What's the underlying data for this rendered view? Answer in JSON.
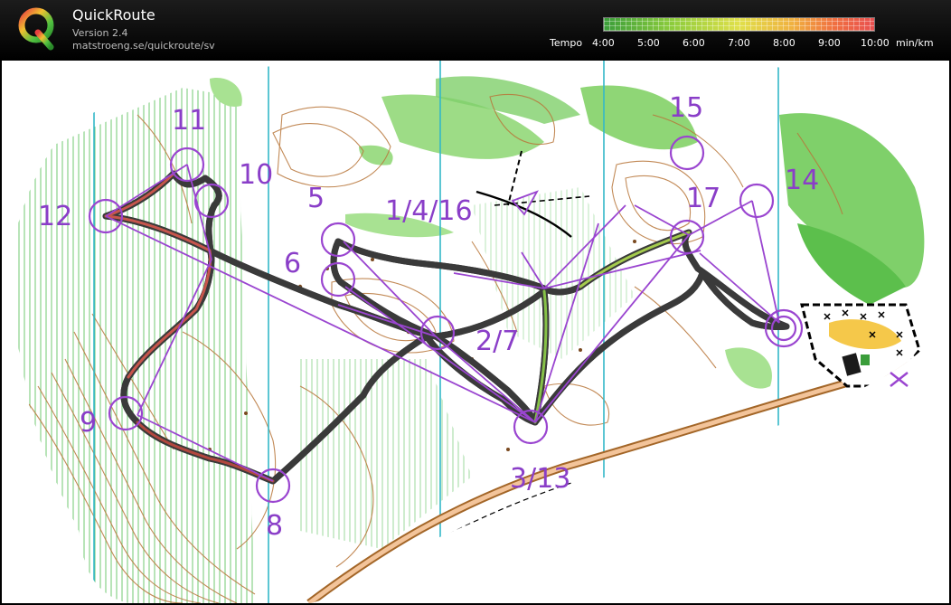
{
  "app": {
    "title": "QuickRoute",
    "version": "Version 2.4",
    "url": "matstroeng.se/quickroute/sv"
  },
  "tempo_legend": {
    "label": "Tempo",
    "ticks": [
      "4:00",
      "5:00",
      "6:00",
      "7:00",
      "8:00",
      "9:00",
      "10:00"
    ],
    "unit": "min/km",
    "colors": [
      "#3a9d3a",
      "#8ccc3c",
      "#e0e04a",
      "#f0b040",
      "#f07040",
      "#e85050"
    ]
  },
  "controls": {
    "c1": "1/4/16",
    "c2": "2/7",
    "c3": "3/13",
    "c5": "5",
    "c6": "6",
    "c8": "8",
    "c9": "9",
    "c10": "10",
    "c11": "11",
    "c12": "12",
    "c14": "14",
    "c15": "15",
    "c17": "17"
  },
  "colors": {
    "course": "#9a45d0",
    "contour": "#b8763a",
    "vegetation": "#7fd06a",
    "magnetic_north": "#33b8c8"
  }
}
